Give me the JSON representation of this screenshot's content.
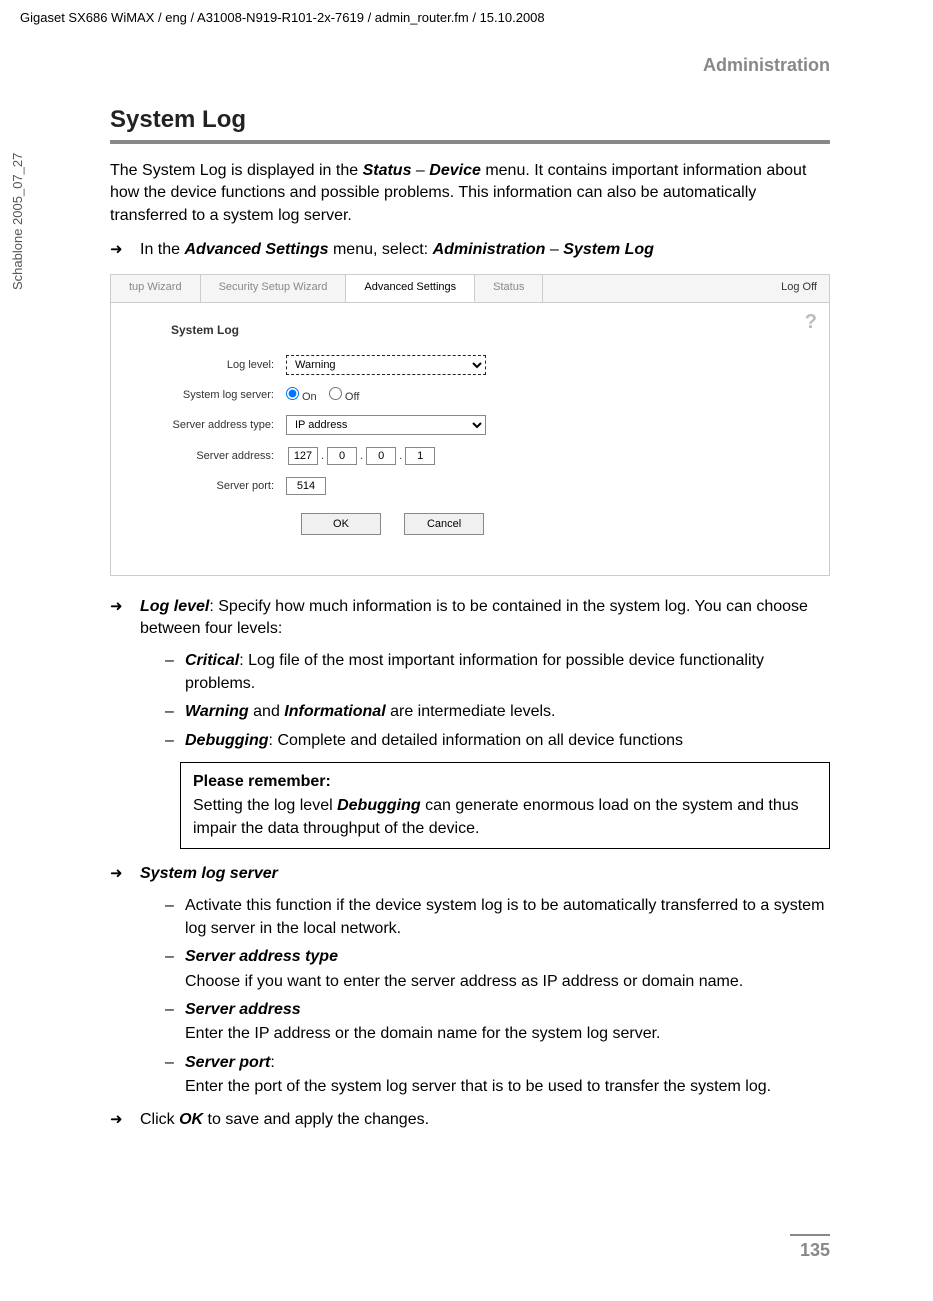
{
  "header_path": "Gigaset SX686 WiMAX / eng / A31008-N919-R101-2x-7619 / admin_router.fm / 15.10.2008",
  "side_label": "Schablone 2005_07_27",
  "section_label": "Administration",
  "main_heading": "System Log",
  "intro_part1": "The System Log is displayed in the ",
  "intro_status": "Status",
  "intro_dash": " – ",
  "intro_device": "Device",
  "intro_part2": " menu. It contains important information about how the device functions and possible problems. This information can also be automatically transferred to a system log server.",
  "nav_prefix": " In the ",
  "nav_adv": "Advanced Settings",
  "nav_mid": " menu, select: ",
  "nav_admin": "Administration",
  "nav_dash": " – ",
  "nav_syslog": "System Log",
  "ui": {
    "tabs": {
      "t1": "tup Wizard",
      "t2": "Security Setup Wizard",
      "t3": "Advanced Settings",
      "t4": "Status"
    },
    "logoff": "Log Off",
    "help": "?",
    "title": "System Log",
    "labels": {
      "loglevel": "Log level:",
      "server": "System log server:",
      "addrtype": "Server address type:",
      "addr": "Server address:",
      "port": "Server port:"
    },
    "fields": {
      "loglevel_value": "Warning",
      "radio_on": "On",
      "radio_off": "Off",
      "addrtype_value": "IP address",
      "ip1": "127",
      "ip2": "0",
      "ip3": "0",
      "ip4": "1",
      "port_value": "514"
    },
    "buttons": {
      "ok": "OK",
      "cancel": "Cancel"
    }
  },
  "loglevel_term": "Log level",
  "loglevel_text": ": Specify how much information is to be contained in the system log. You can choose between four levels:",
  "levels": {
    "critical_term": "Critical",
    "critical_text": ": Log file of the most important information for possible device functionality problems.",
    "warning_term": "Warning",
    "warning_mid": " and ",
    "info_term": "Informational",
    "warning_text": " are intermediate levels.",
    "debug_term": "Debugging",
    "debug_text": ": Complete and detailed information on all device functions"
  },
  "note": {
    "title": "Please remember:",
    "text_pre": "Setting the log level ",
    "text_term": "Debugging",
    "text_post": " can generate enormous load on the system and thus impair the data throughput of the device."
  },
  "server_section": "System log server",
  "server_items": {
    "activate": "Activate this function if the device system log is to be automatically transferred to a system log server in the local network.",
    "addrtype_term": "Server address type",
    "addrtype_text": "Choose if you want to enter the server address as IP address or domain name.",
    "addr_term": "Server address",
    "addr_text": "Enter the IP address or the domain name for the system log server.",
    "port_term": "Server port",
    "port_colon": ":",
    "port_text": "Enter the port of the system log server that is to be used to transfer the system log."
  },
  "click_ok_pre": "Click ",
  "click_ok_term": "OK",
  "click_ok_post": " to save and apply the changes.",
  "page_number": "135",
  "chart_data": {
    "type": "table",
    "title": "System Log configuration form",
    "rows": [
      {
        "label": "Log level",
        "value": "Warning"
      },
      {
        "label": "System log server",
        "value": "On"
      },
      {
        "label": "Server address type",
        "value": "IP address"
      },
      {
        "label": "Server address",
        "value": "127.0.0.1"
      },
      {
        "label": "Server port",
        "value": "514"
      }
    ]
  }
}
